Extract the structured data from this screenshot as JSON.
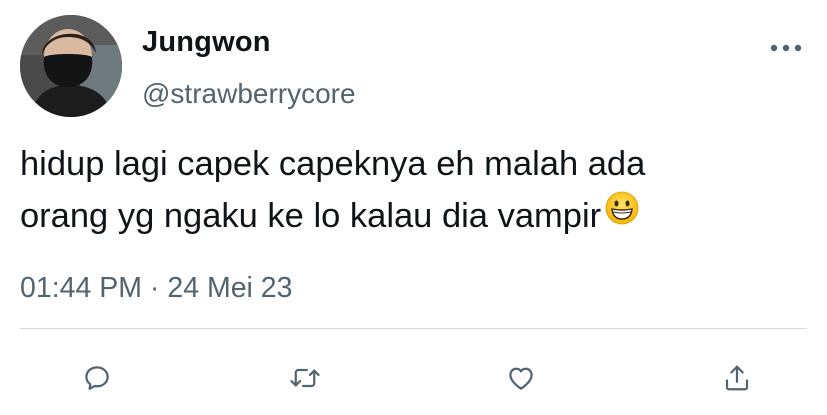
{
  "tweet": {
    "display_name": "Jungwon",
    "handle": "@strawberrycore",
    "text_lines": [
      "hidup lagi capek capeknya eh malah ada",
      "orang yg ngaku ke lo kalau dia vampir"
    ],
    "emoji": "grinning-face-emoji",
    "time": "01:44 PM",
    "separator": "·",
    "date": "24 Mei 23"
  },
  "header": {
    "more_icon": "more-horizontal-icon"
  },
  "actions": [
    {
      "name": "reply",
      "icon": "reply-icon"
    },
    {
      "name": "retweet",
      "icon": "retweet-icon"
    },
    {
      "name": "like",
      "icon": "heart-icon"
    },
    {
      "name": "share",
      "icon": "share-icon"
    }
  ],
  "colors": {
    "text": "#0f1419",
    "secondary": "#536471",
    "divider": "#cfd9de",
    "background": "#ffffff"
  }
}
